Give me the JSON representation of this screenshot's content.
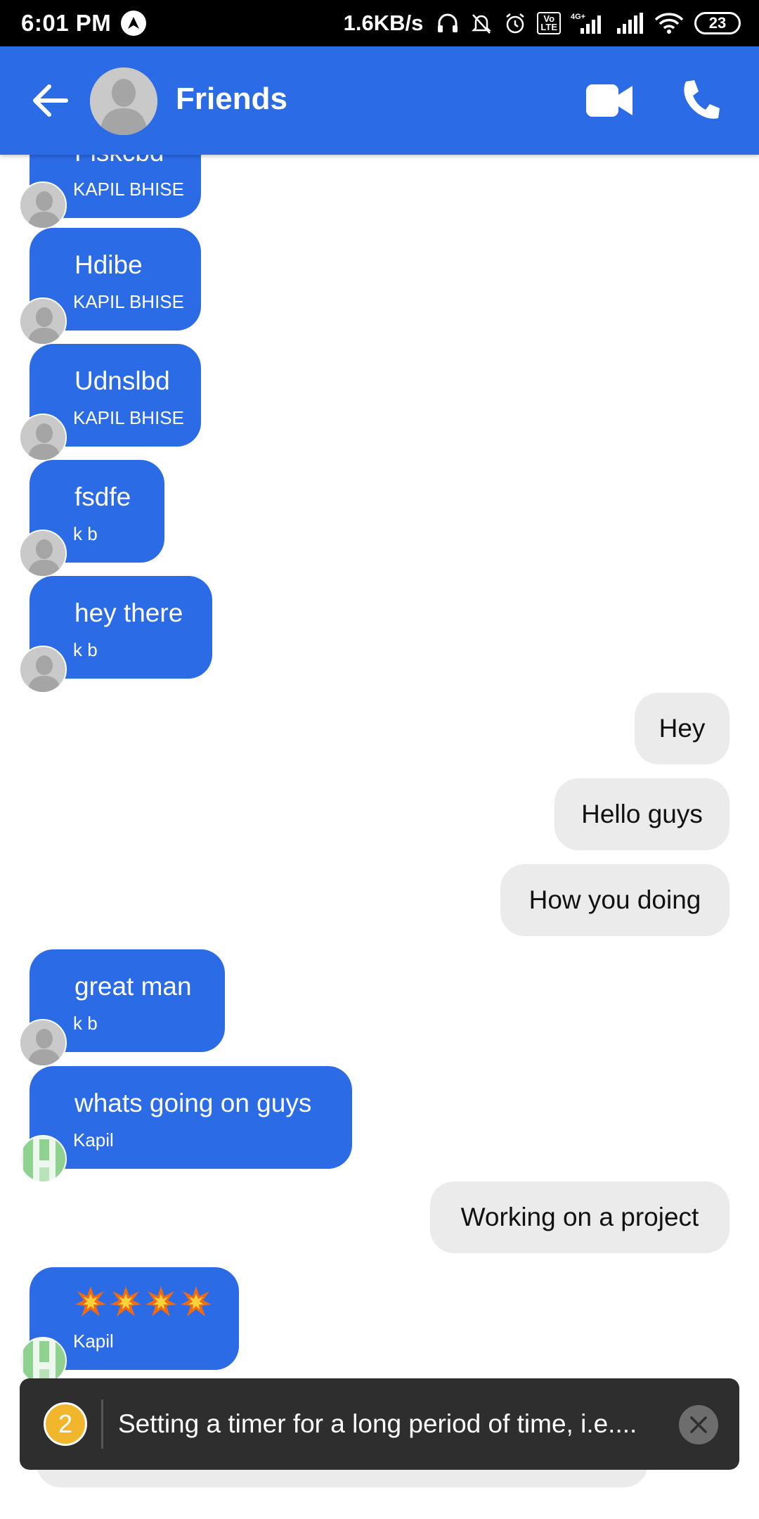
{
  "status_bar": {
    "time": "6:01 PM",
    "net_speed": "1.6KB/s",
    "volte": "Vo LTE",
    "network": "4G+",
    "battery": "23"
  },
  "header": {
    "title": "Friends"
  },
  "messages": [
    {
      "type": "incoming",
      "text": "Fiskcbd",
      "sender": "KAPIL BHISE"
    },
    {
      "type": "incoming",
      "text": "Hdibe",
      "sender": "KAPIL BHISE"
    },
    {
      "type": "incoming",
      "text": "Udnslbd",
      "sender": "KAPIL BHISE"
    },
    {
      "type": "incoming",
      "text": "fsdfe",
      "sender": "k b"
    },
    {
      "type": "incoming",
      "text": "hey there",
      "sender": "k b"
    },
    {
      "type": "outgoing",
      "text": "Hey"
    },
    {
      "type": "outgoing",
      "text": "Hello guys"
    },
    {
      "type": "outgoing",
      "text": "How you doing"
    },
    {
      "type": "incoming",
      "text": "great man",
      "sender": "k b"
    },
    {
      "type": "incoming",
      "text": "whats going on guys",
      "sender": "Kapil"
    },
    {
      "type": "outgoing",
      "text": "Working on a project"
    },
    {
      "type": "incoming",
      "emoji": [
        "collision-emoji",
        "collision-emoji",
        "collision-emoji",
        "collision-emoji"
      ],
      "sender": "Kapil"
    }
  ],
  "toast": {
    "count": "2",
    "text": "Setting a timer for a long period of time, i.e...."
  },
  "colors": {
    "brand_blue": "#2b6be6",
    "outgoing_bubble": "#ebebeb",
    "toast_bg": "#2e2e2e",
    "badge_yellow": "#f2b62c"
  }
}
